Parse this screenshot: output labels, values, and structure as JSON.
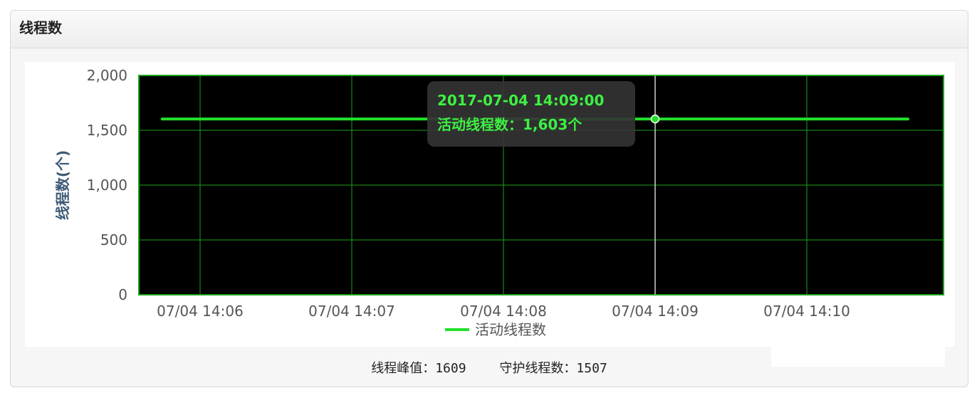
{
  "panel": {
    "title": "线程数"
  },
  "footer": {
    "peak_label": "线程峰值：",
    "peak_value": "1609",
    "daemon_label": "守护线程数：",
    "daemon_value": "1507"
  },
  "tooltip": {
    "time": "2017-07-04 14:09:00",
    "text": "活动线程数：1,603个"
  },
  "colors": {
    "plot_bg": "#000000",
    "grid": "#1aa31a",
    "series": "#22e02a",
    "tooltip_bg": "#333333",
    "tooltip_text": "#3ef043",
    "axis_text": "#555555",
    "ylabel": "#3d5a75"
  },
  "chart_data": {
    "type": "line",
    "title": "",
    "ylabel": "线程数(个)",
    "xlabel": "",
    "ylim": [
      0,
      2000
    ],
    "yticks": [
      0,
      500,
      1000,
      1500,
      2000
    ],
    "ytick_labels": [
      "0",
      "500",
      "1,000",
      "1,500",
      "2,000"
    ],
    "xticks": [
      "07/04 14:06",
      "07/04 14:07",
      "07/04 14:08",
      "07/04 14:09",
      "07/04 14:10"
    ],
    "grid": true,
    "legend": "bottom-center",
    "series": [
      {
        "name": "活动线程数",
        "x": [
          "07/04 14:05:45",
          "07/04 14:06",
          "07/04 14:07",
          "07/04 14:08",
          "07/04 14:09",
          "07/04 14:10",
          "07/04 14:10:40"
        ],
        "values": [
          1603,
          1603,
          1603,
          1603,
          1603,
          1603,
          1603
        ]
      }
    ],
    "highlight": {
      "x": "07/04 14:09",
      "value": 1603
    }
  }
}
